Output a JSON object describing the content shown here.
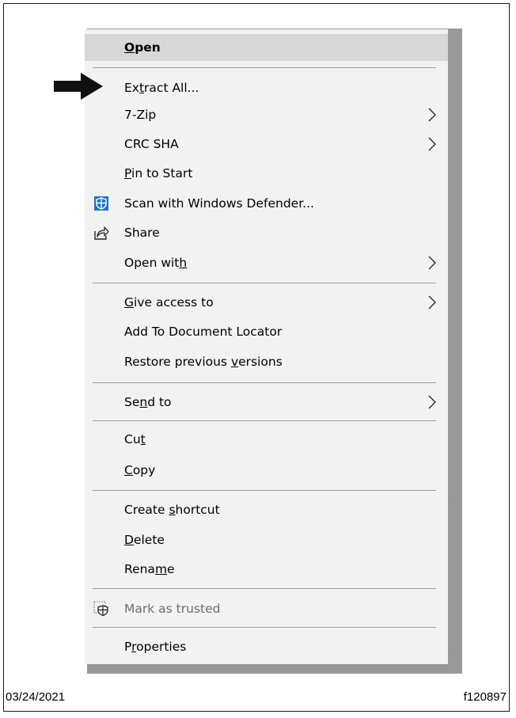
{
  "menu": {
    "items": [
      {
        "text": "Open",
        "ul": 0,
        "bold": true,
        "highlight": true
      },
      {
        "text": "Extract All...",
        "ul": 2
      },
      {
        "text": "7-Zip",
        "submenu": true
      },
      {
        "text": "CRC SHA",
        "submenu": true
      },
      {
        "text": "Pin to Start",
        "ul": 0
      },
      {
        "text": "Scan with Windows Defender...",
        "icon": "windows-defender-shield-icon"
      },
      {
        "text": "Share",
        "icon": "share-icon"
      },
      {
        "text": "Open with",
        "ul": 8,
        "submenu": true
      },
      {
        "text": "Give access to",
        "ul": 0,
        "submenu": true
      },
      {
        "text": "Add To Document Locator"
      },
      {
        "text": "Restore previous versions",
        "ul": 17
      },
      {
        "text": "Send to",
        "ul": 2,
        "submenu": true
      },
      {
        "text": "Cut",
        "ul": 2
      },
      {
        "text": "Copy",
        "ul": 0
      },
      {
        "text": "Create shortcut",
        "ul": 7
      },
      {
        "text": "Delete",
        "ul": 0
      },
      {
        "text": "Rename",
        "ul": 4
      },
      {
        "text": "Mark as trusted",
        "icon": "mark-trusted-shield-icon",
        "disabled": true
      },
      {
        "text": "Properties",
        "ul": 1
      }
    ]
  },
  "pointer": {
    "icon": "right-arrow-icon",
    "target": "Extract All..."
  },
  "footer": {
    "date": "03/24/2021",
    "figure_id": "f120897"
  },
  "colors": {
    "menu_bg": "#f2f2f2",
    "highlight_bg": "#d7d7d7",
    "separator": "#a0a0a0",
    "disabled_text": "#6e6e6e"
  }
}
